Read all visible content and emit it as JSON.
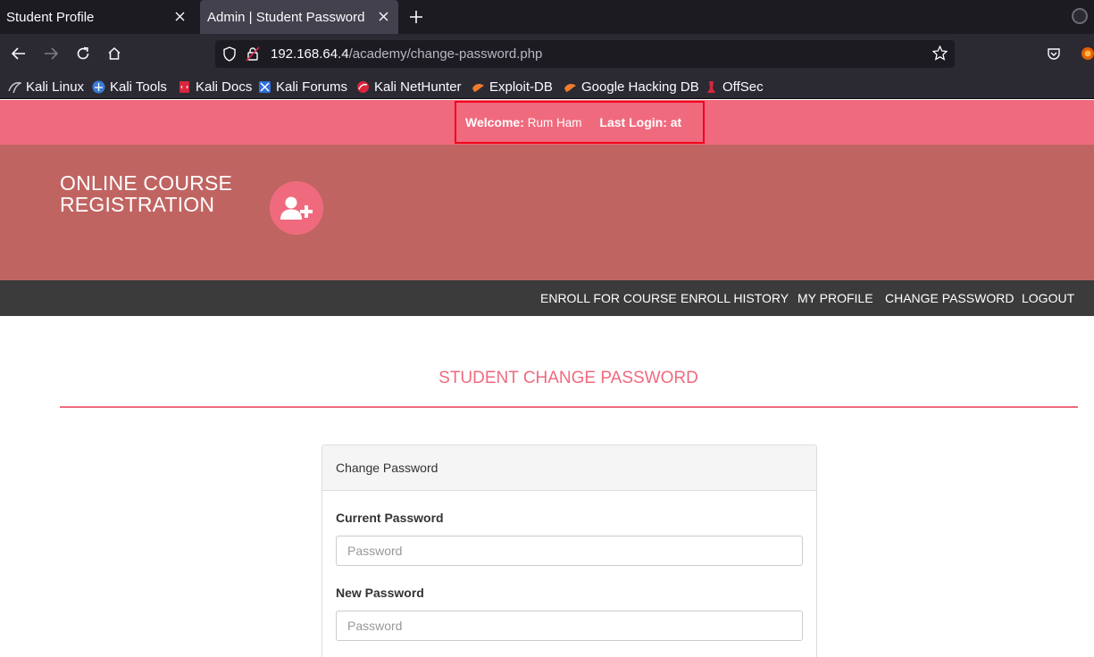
{
  "browser": {
    "tabs": [
      {
        "title": "Student Profile",
        "active": false
      },
      {
        "title": "Admin | Student Password",
        "active": true
      }
    ],
    "url_host": "192.168.64.4",
    "url_path": "/academy/change-password.php",
    "bookmarks": [
      {
        "label": "Kali Linux",
        "icon": "kali-dragon-icon"
      },
      {
        "label": "Kali Tools",
        "icon": "kali-tools-icon"
      },
      {
        "label": "Kali Docs",
        "icon": "kali-docs-icon"
      },
      {
        "label": "Kali Forums",
        "icon": "kali-forums-icon"
      },
      {
        "label": "Kali NetHunter",
        "icon": "nethunter-icon"
      },
      {
        "label": "Exploit-DB",
        "icon": "exploit-db-icon"
      },
      {
        "label": "Google Hacking DB",
        "icon": "ghdb-icon"
      },
      {
        "label": "OffSec",
        "icon": "offsec-icon"
      }
    ]
  },
  "topbar": {
    "welcome_label": "Welcome:",
    "user_name": "Rum Ham",
    "last_login_label": "Last Login: at",
    "highlight_color": "#f2001a"
  },
  "header": {
    "brand_line1": "ONLINE COURSE",
    "brand_line2": "REGISTRATION",
    "brand_icon": "user-plus-icon"
  },
  "menu": {
    "items": [
      "ENROLL FOR COURSE",
      "ENROLL HISTORY",
      "MY PROFILE",
      "CHANGE PASSWORD",
      "LOGOUT"
    ]
  },
  "main": {
    "heading": "STUDENT CHANGE PASSWORD",
    "panel_title": "Change Password",
    "fields": [
      {
        "label": "Current Password",
        "placeholder": "Password"
      },
      {
        "label": "New Password",
        "placeholder": "Password"
      }
    ]
  },
  "colors": {
    "accent_pink": "#f06a7e",
    "header_bg": "#c06462",
    "menu_bg": "#3b3b3b"
  }
}
